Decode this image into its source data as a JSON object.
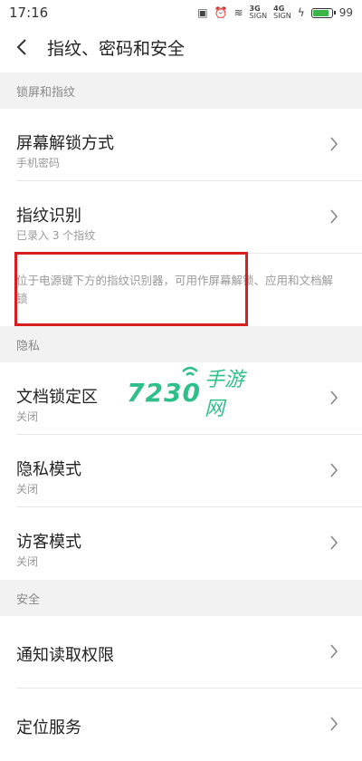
{
  "status_bar": {
    "time": "17:16",
    "sig1": "3G",
    "sig1_sub": "SIGN",
    "sig2": "4G",
    "sig2_sub": "SIGN",
    "battery_level": "99",
    "battery_fraction": 0.8
  },
  "header": {
    "title": "指纹、密码和安全"
  },
  "sections": {
    "lock": "锁屏和指纹",
    "privacy": "隐私",
    "security": "安全"
  },
  "rows": {
    "screen_unlock": {
      "label": "屏幕解锁方式",
      "sub": "手机密码"
    },
    "fingerprint": {
      "label": "指纹识别",
      "sub": "已录入 3 个指纹"
    },
    "doc_lock": {
      "label": "文档锁定区",
      "sub": "关闭"
    },
    "privacy_mode": {
      "label": "隐私模式",
      "sub": "关闭"
    },
    "guest_mode": {
      "label": "访客模式",
      "sub": "关闭"
    },
    "notification_access": {
      "label": "通知读取权限"
    },
    "location": {
      "label": "定位服务"
    }
  },
  "description": "位于电源键下方的指纹识别器，可用作屏幕解锁、应用和文档解锁",
  "watermark": {
    "num": "7230",
    "text": "手游网"
  },
  "colors": {
    "accent_red": "#d81e1e",
    "watermark_green": "#2fbf8a",
    "battery_green": "#39b54a"
  }
}
